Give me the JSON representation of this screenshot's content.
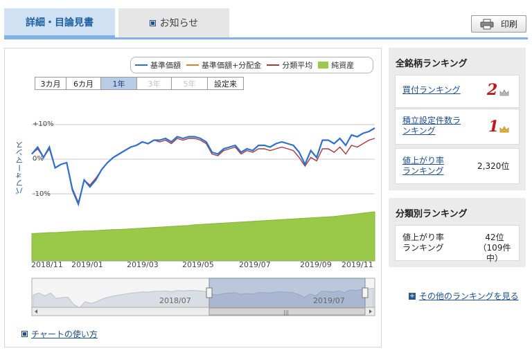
{
  "tabs": {
    "active": "詳細・目論見書",
    "inactive": "お知らせ"
  },
  "print_button": "印刷",
  "legend": [
    {
      "label": "基準価額",
      "color": "#2f6fcf",
      "kind": "line"
    },
    {
      "label": "基準価額+分配金",
      "color": "#e07b2a",
      "kind": "line"
    },
    {
      "label": "分類平均",
      "color": "#a53a3a",
      "kind": "line"
    },
    {
      "label": "純資産",
      "color": "#9ac94a",
      "kind": "area"
    }
  ],
  "periods": [
    {
      "label": "3カ月",
      "state": "normal"
    },
    {
      "label": "6カ月",
      "state": "normal"
    },
    {
      "label": "1年",
      "state": "active"
    },
    {
      "label": "3年",
      "state": "disabled"
    },
    {
      "label": "5年",
      "state": "disabled"
    },
    {
      "label": "設定来",
      "state": "normal"
    }
  ],
  "chart_data": {
    "type": "line",
    "ylabel": "パフォーマンス",
    "yticks": [
      "+10%",
      "0%",
      "-10%"
    ],
    "ylim": [
      -16,
      16
    ],
    "xticks": [
      "2018/11",
      "2019/01",
      "2019/03",
      "2019/05",
      "2019/07",
      "2019/09",
      "2019/11"
    ],
    "navigator_ticks": [
      "2018/07",
      "2019/07"
    ],
    "series": [
      {
        "name": "基準価額",
        "color": "#2f6fcf",
        "values": [
          1.5,
          3.5,
          0.5,
          3.5,
          -2.5,
          -1.5,
          -1,
          -9,
          -13,
          -6,
          -8,
          -6,
          -3,
          -1,
          0.5,
          1.5,
          2.5,
          3.5,
          4,
          5,
          4.5,
          5.5,
          5.5,
          6,
          5,
          6.5,
          6,
          6.5,
          6.5,
          6,
          5,
          2,
          1.5,
          3,
          3.5,
          4,
          2,
          3,
          2.5,
          4,
          4,
          3.5,
          4.5,
          5,
          4.5,
          4,
          2,
          -1.5,
          2.5,
          0.5,
          5.5,
          5.5,
          4.5,
          6,
          4,
          7,
          6.5,
          7.5,
          8,
          9
        ]
      },
      {
        "name": "基準価額+分配金",
        "color": "#e07b2a",
        "values": [
          1.5,
          3.5,
          0.5,
          3.5,
          -2.5,
          -1.5,
          -1,
          -9,
          -13,
          -6,
          -8,
          -6,
          -3,
          -1,
          0.5,
          1.5,
          2.5,
          3.5,
          4,
          5,
          4.5,
          5.5,
          5.5,
          6,
          5,
          6.5,
          6,
          6.5,
          6.5,
          6,
          5,
          2,
          1.5,
          3,
          3.5,
          4,
          2,
          3,
          2.5,
          4,
          4,
          3.5,
          4.5,
          5,
          4.5,
          4,
          2,
          -1.5,
          2.5,
          0.5,
          5.5,
          5.5,
          4.5,
          6,
          4,
          7,
          6.5,
          7.5,
          8,
          9
        ]
      },
      {
        "name": "分類平均",
        "color": "#a53a3a",
        "values": [
          1.5,
          3,
          0.5,
          3,
          -2.5,
          -1.5,
          -1,
          -8.5,
          -12.5,
          -6,
          -7.5,
          -5.5,
          -3,
          -1,
          0.5,
          1.5,
          2.5,
          3.5,
          4,
          5,
          4.5,
          5.5,
          5,
          5.5,
          4.5,
          6,
          5.5,
          6,
          6,
          5.5,
          4.5,
          1.5,
          1,
          2.5,
          3,
          3.5,
          1.5,
          2.5,
          2,
          3,
          3,
          2.5,
          3,
          3.5,
          3,
          2.5,
          0.5,
          -2,
          0.5,
          -0.5,
          3,
          3,
          2,
          3.5,
          1.5,
          4,
          3.5,
          4.5,
          5.5,
          6
        ]
      },
      {
        "name": "純資産",
        "color": "#9ac94a",
        "values": [
          40,
          40.5,
          41,
          41.5,
          41.5,
          42,
          42.5,
          43,
          43.5,
          44,
          44,
          44.5,
          45,
          45.5,
          46,
          46,
          46.5,
          47,
          47.5,
          48,
          48.5,
          49,
          49.5,
          50,
          50.5,
          51,
          51.5,
          52,
          53,
          53.5,
          54,
          54.5,
          55,
          55.5,
          56,
          56.5,
          57,
          57.5,
          58,
          58.5,
          59,
          59.5,
          60,
          60.5,
          61,
          61.5,
          62,
          62.5,
          63,
          63.5,
          64,
          64.5,
          65,
          66,
          67,
          68,
          69,
          70,
          71,
          72
        ]
      }
    ]
  },
  "chart_link": "チャートの使い方",
  "ranking_all": {
    "title": "全銘柄ランキング",
    "items": [
      {
        "label": "買付ランキング",
        "rank": "2",
        "icon": "crown-icon"
      },
      {
        "label": "積立設定件数ランキング",
        "rank": "1",
        "icon": "crown-icon"
      },
      {
        "label_line1": "値上がり率",
        "label_line2": "ランキング",
        "value": "2,320位"
      }
    ]
  },
  "ranking_category": {
    "title": "分類別ランキング",
    "label_line1": "値上がり率",
    "label_line2": "ランキング",
    "value_line1": "42位",
    "value_line2": "（109件中）"
  },
  "more_link": "その他のランキングを見る"
}
